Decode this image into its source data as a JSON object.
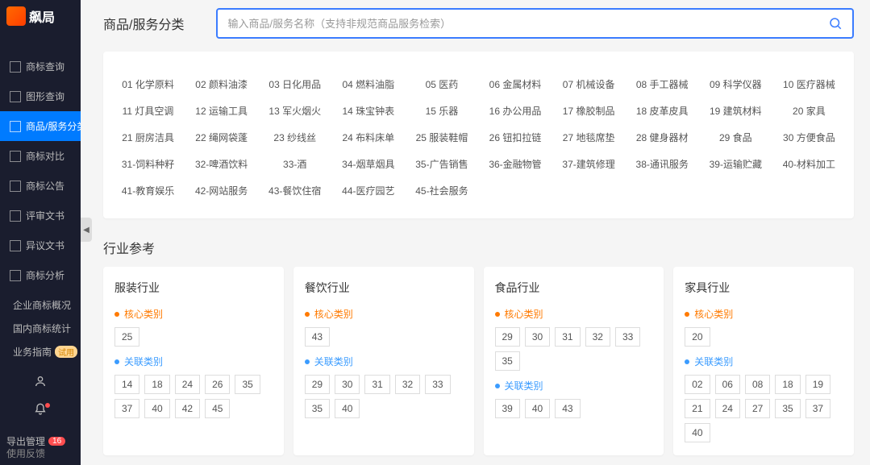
{
  "logo": {
    "text": "飙局"
  },
  "nav": {
    "items": [
      {
        "label": "商标查询"
      },
      {
        "label": "图形查询"
      },
      {
        "label": "商品/服务分类",
        "active": true
      },
      {
        "label": "商标对比"
      },
      {
        "label": "商标公告"
      },
      {
        "label": "评审文书"
      },
      {
        "label": "异议文书"
      },
      {
        "label": "商标分析"
      }
    ],
    "subs": [
      {
        "label": "企业商标概况"
      },
      {
        "label": "国内商标统计"
      },
      {
        "label": "业务指南",
        "badge": "试用"
      }
    ],
    "export": {
      "label": "导出管理",
      "count": "16"
    },
    "feedback": "使用反馈"
  },
  "header": {
    "title": "商品/服务分类",
    "search_placeholder": "输入商品/服务名称（支持非规范商品服务检索）"
  },
  "categories": [
    "01 化学原料",
    "02 颜料油漆",
    "03 日化用品",
    "04 燃料油脂",
    "05 医药",
    "06 金属材料",
    "07 机械设备",
    "08 手工器械",
    "09 科学仪器",
    "10 医疗器械",
    "11 灯具空调",
    "12 运输工具",
    "13 军火烟火",
    "14 珠宝钟表",
    "15 乐器",
    "16 办公用品",
    "17 橡胶制品",
    "18 皮革皮具",
    "19 建筑材料",
    "20 家具",
    "21 厨房洁具",
    "22 绳网袋蓬",
    "23 纱线丝",
    "24 布料床单",
    "25 服装鞋帽",
    "26 钮扣拉链",
    "27 地毯席垫",
    "28 健身器材",
    "29 食品",
    "30 方便食品",
    "31-饲料种籽",
    "32-啤酒饮料",
    "33-酒",
    "34-烟草烟具",
    "35-广告销售",
    "36-金融物管",
    "37-建筑修理",
    "38-通讯服务",
    "39-运输贮藏",
    "40-材料加工",
    "41-教育娱乐",
    "42-网站服务",
    "43-餐饮住宿",
    "44-医疗园艺",
    "45-社会服务"
  ],
  "industry_section_title": "行业参考",
  "group_labels": {
    "core": "核心类别",
    "related": "关联类别"
  },
  "industries": [
    {
      "title": "服装行业",
      "core": [
        "25"
      ],
      "related": [
        "14",
        "18",
        "24",
        "26",
        "35",
        "37",
        "40",
        "42",
        "45"
      ]
    },
    {
      "title": "餐饮行业",
      "core": [
        "43"
      ],
      "related": [
        "29",
        "30",
        "31",
        "32",
        "33",
        "35",
        "40"
      ]
    },
    {
      "title": "食品行业",
      "core": [
        "29",
        "30",
        "31",
        "32",
        "33",
        "35"
      ],
      "related": [
        "39",
        "40",
        "43"
      ]
    },
    {
      "title": "家具行业",
      "core": [
        "20"
      ],
      "related": [
        "02",
        "06",
        "08",
        "18",
        "19",
        "21",
        "24",
        "27",
        "35",
        "37",
        "40"
      ]
    }
  ]
}
